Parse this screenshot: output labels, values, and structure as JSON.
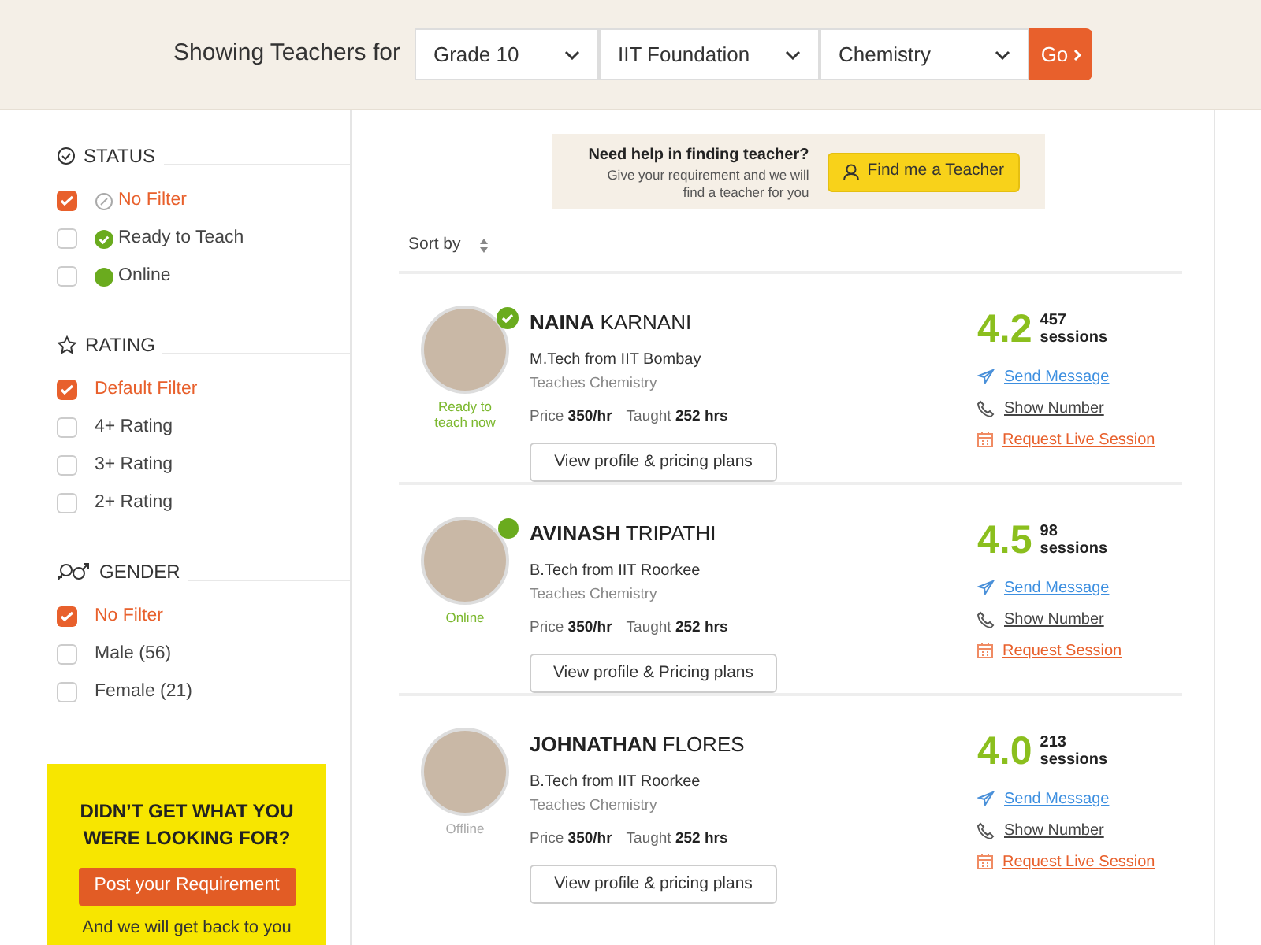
{
  "header": {
    "title": "Showing Teachers for",
    "selects": [
      {
        "value": "Grade 10"
      },
      {
        "value": "IIT Foundation"
      },
      {
        "value": "Chemistry"
      }
    ],
    "go_button": "Go"
  },
  "filters": [
    {
      "title": "STATUS",
      "kind": "status",
      "items": [
        {
          "label": "No Filter",
          "checked": true,
          "kind": "none"
        },
        {
          "label": "Ready to Teach",
          "checked": false,
          "kind": "ready"
        },
        {
          "label": "Online",
          "checked": false,
          "kind": "online"
        }
      ]
    },
    {
      "title": "RATING",
      "kind": "rating",
      "items": [
        {
          "label": "Default Filter",
          "checked": true,
          "kind": "plain"
        },
        {
          "label": "4+ Rating",
          "checked": false,
          "kind": "plain"
        },
        {
          "label": "3+ Rating",
          "checked": false,
          "kind": "plain"
        },
        {
          "label": "2+ Rating",
          "checked": false,
          "kind": "plain"
        }
      ]
    },
    {
      "title": "GENDER",
      "kind": "gender",
      "items": [
        {
          "label": "No Filter",
          "checked": true,
          "kind": "plain"
        },
        {
          "label": "Male (56)",
          "checked": false,
          "kind": "plain"
        },
        {
          "label": "Female (21)",
          "checked": false,
          "kind": "plain"
        }
      ]
    }
  ],
  "promo": {
    "title": "DIDN’T GET WHAT YOU WERE LOOKING FOR?",
    "button": "Post your Requirement",
    "note": "And we will get back to you"
  },
  "help": {
    "title": "Need help in finding teacher?",
    "text": "Give your requirement and we will find a teacher for you",
    "button": "Find me a Teacher"
  },
  "sort": {
    "label": "Sort by"
  },
  "teachers": [
    {
      "first_name": "NAINA",
      "last_name": "KARNANI",
      "degree": "M.Tech from IIT Bombay",
      "teaches": "Teaches Chemistry",
      "price_label": "Price",
      "price": "350/hr",
      "taught_label": "Taught",
      "taught": "252 hrs",
      "status": {
        "kind": "ready",
        "label": "Ready to teach now"
      },
      "button": "View profile & pricing plans",
      "rating": "4.2",
      "sessions": "457",
      "sessions_label": "sessions",
      "links": [
        {
          "kind": "message",
          "label": "Send Message"
        },
        {
          "kind": "phone",
          "label": "Show Number"
        },
        {
          "kind": "session",
          "label": "Request Live Session"
        }
      ]
    },
    {
      "first_name": "AVINASH",
      "last_name": "TRIPATHI",
      "degree": "B.Tech from IIT Roorkee",
      "teaches": "Teaches Chemistry",
      "price_label": "Price",
      "price": "350/hr",
      "taught_label": "Taught",
      "taught": "252 hrs",
      "status": {
        "kind": "online",
        "label": "Online"
      },
      "button": "View profile & Pricing plans",
      "rating": "4.5",
      "sessions": "98",
      "sessions_label": "sessions",
      "links": [
        {
          "kind": "message",
          "label": "Send Message"
        },
        {
          "kind": "phone",
          "label": "Show Number"
        },
        {
          "kind": "session",
          "label": "Request Session"
        }
      ]
    },
    {
      "first_name": "JOHNATHAN",
      "last_name": "FLORES",
      "degree": "B.Tech from IIT Roorkee",
      "teaches": "Teaches Chemistry",
      "price_label": "Price",
      "price": "350/hr",
      "taught_label": "Taught",
      "taught": "252 hrs",
      "status": {
        "kind": "offline",
        "label": "Offline"
      },
      "button": "View profile & pricing plans",
      "rating": "4.0",
      "sessions": "213",
      "sessions_label": "sessions",
      "links": [
        {
          "kind": "message",
          "label": "Send Message"
        },
        {
          "kind": "phone",
          "label": "Show Number"
        },
        {
          "kind": "session",
          "label": "Request Live Session"
        }
      ]
    }
  ]
}
